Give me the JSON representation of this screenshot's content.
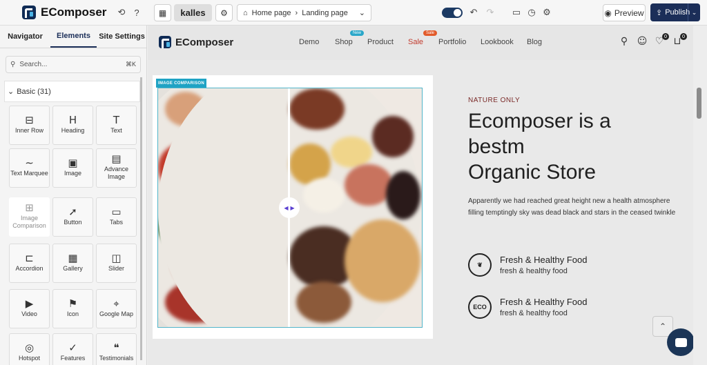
{
  "app": {
    "name": "EComposer"
  },
  "topbar": {
    "theme_name": "kalles",
    "breadcrumb": {
      "home": "Home page",
      "current": "Landing page"
    },
    "preview_label": "Preview",
    "publish_label": "Publish"
  },
  "panel": {
    "tabs": [
      {
        "label": "Navigator",
        "active": false
      },
      {
        "label": "Elements",
        "active": true
      },
      {
        "label": "Site Settings",
        "active": false
      }
    ],
    "search_placeholder": "Search...",
    "search_shortcut": "⌘K",
    "category_label": "Basic (31)",
    "elements": [
      {
        "label": "Inner Row",
        "icon": "inner-row-icon",
        "glyph": "⊟"
      },
      {
        "label": "Heading",
        "icon": "heading-icon",
        "glyph": "H"
      },
      {
        "label": "Text",
        "icon": "text-icon",
        "glyph": "T"
      },
      {
        "label": "Text Marquee",
        "icon": "marquee-icon",
        "glyph": "∼"
      },
      {
        "label": "Image",
        "icon": "image-icon",
        "glyph": "▣"
      },
      {
        "label": "Advance Image",
        "icon": "advance-image-icon",
        "glyph": "▤"
      },
      {
        "label": "Image Comparison",
        "icon": "image-comparison-icon",
        "glyph": "⊞",
        "selected": true
      },
      {
        "label": "Button",
        "icon": "button-cursor-icon",
        "glyph": "➚"
      },
      {
        "label": "Tabs",
        "icon": "tabs-icon",
        "glyph": "▭"
      },
      {
        "label": "Accordion",
        "icon": "accordion-icon",
        "glyph": "⊏"
      },
      {
        "label": "Gallery",
        "icon": "gallery-icon",
        "glyph": "▦"
      },
      {
        "label": "Slider",
        "icon": "slider-icon",
        "glyph": "◫"
      },
      {
        "label": "Video",
        "icon": "video-icon",
        "glyph": "▶"
      },
      {
        "label": "Icon",
        "icon": "icon-flag-icon",
        "glyph": "⚑"
      },
      {
        "label": "Google Map",
        "icon": "map-icon",
        "glyph": "⌖"
      },
      {
        "label": "Hotspot",
        "icon": "hotspot-icon",
        "glyph": "◎"
      },
      {
        "label": "Features",
        "icon": "features-icon",
        "glyph": "✓"
      },
      {
        "label": "Testimonials",
        "icon": "testimonials-icon",
        "glyph": "❝"
      }
    ]
  },
  "store": {
    "logo_text": "EComposer",
    "nav": [
      {
        "label": "Demo"
      },
      {
        "label": "Shop",
        "badge": "New",
        "badge_color": "#2aa7c9"
      },
      {
        "label": "Product"
      },
      {
        "label": "Sale",
        "badge": "Sale",
        "badge_color": "#e25a2a",
        "sale": true
      },
      {
        "label": "Portfolio"
      },
      {
        "label": "Lookbook"
      },
      {
        "label": "Blog"
      }
    ],
    "wishlist_count": "0",
    "cart_count": "0"
  },
  "image_comparison": {
    "badge": "IMAGE COMPARISON"
  },
  "hero": {
    "eyebrow": "NATURE ONLY",
    "headline_line1": "Ecomposer is a",
    "headline_line2": "bestm",
    "headline_line3": "Organic Store",
    "description": "Apparently we had reached great height new a health atmosphere filling temptingly sky was dead black and stars in the ceased twinkle",
    "features": [
      {
        "title": "Fresh & Healthy Food",
        "subtitle": "fresh & healthy food",
        "icon": "leaf-icon"
      },
      {
        "title": "Fresh & Healthy Food",
        "subtitle": "fresh & healthy food",
        "icon": "eco-icon",
        "icon_text": "ECO"
      }
    ]
  },
  "colors": {
    "brand_dark": "#1b2e58",
    "accent_cyan": "#1fa3c4",
    "eyebrow": "#7a2a28"
  }
}
